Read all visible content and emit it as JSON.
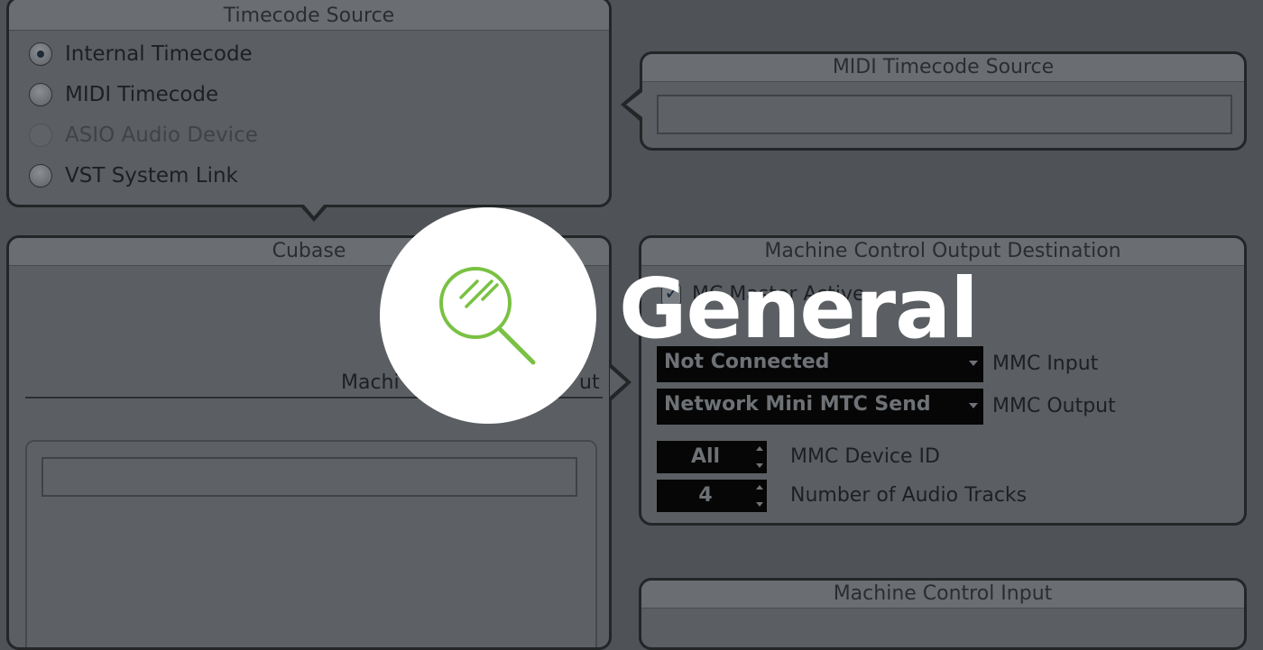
{
  "timecode_source": {
    "title": "Timecode Source",
    "options": [
      {
        "label": "Internal Timecode",
        "selected": true,
        "disabled": false
      },
      {
        "label": "MIDI Timecode",
        "selected": false,
        "disabled": false
      },
      {
        "label": "ASIO Audio Device",
        "selected": false,
        "disabled": true
      },
      {
        "label": "VST System Link",
        "selected": false,
        "disabled": false
      }
    ]
  },
  "midi_timecode_source": {
    "title": "MIDI Timecode Source",
    "value": ""
  },
  "cubase": {
    "title": "Cubase",
    "partial_label_left": "Machi",
    "partial_label_right": "ut"
  },
  "mc_output": {
    "title": "Machine Control Output Destination",
    "master_active_label": "MC Master Active",
    "master_active_checked": true,
    "mmc_input_value": "Not Connected",
    "mmc_input_label": "MMC Input",
    "mmc_output_value": "Network Mini MTC Send",
    "mmc_output_label": "MMC Output",
    "device_id_value": "All",
    "device_id_label": "MMC Device ID",
    "audio_tracks_value": "4",
    "audio_tracks_label": "Number of Audio Tracks"
  },
  "mc_input": {
    "title": "Machine Control Input"
  },
  "overlay": {
    "title": "General",
    "icon": "magnifier-icon",
    "accent": "#7ac143"
  }
}
